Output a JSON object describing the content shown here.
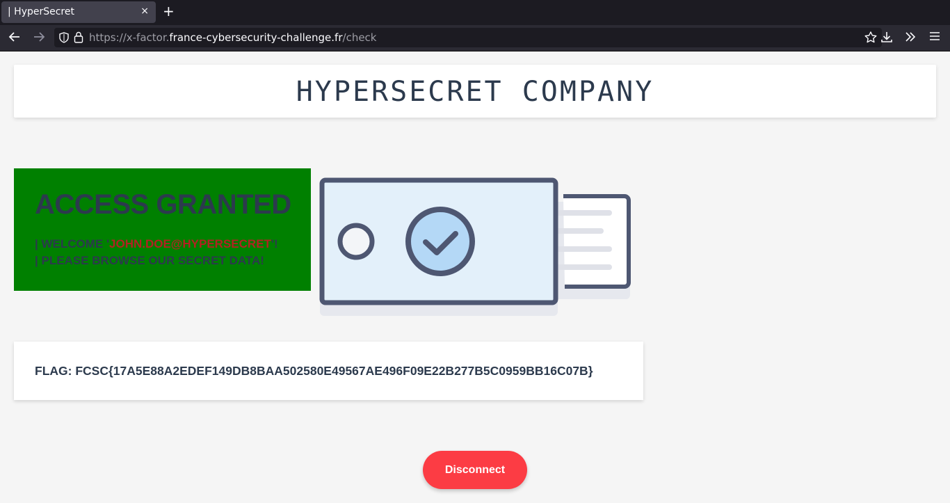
{
  "browser": {
    "tab_title": "| HyperSecret",
    "tab_close": "×",
    "new_tab": "+",
    "url_prefix": "https://x-factor.",
    "url_host": "france-cybersecurity-challenge.fr",
    "url_path": "/check"
  },
  "page": {
    "company_title": "HYPERSECRET COMPANY",
    "access_title": "ACCESS GRANTED",
    "welcome_prefix": "| WELCOME '",
    "welcome_email": "JOHN.DOE@HYPERSECRET",
    "welcome_suffix": "'!",
    "browse_line": "| PLEASE BROWSE OUR SECRET DATA!",
    "flag": "FLAG: FCSC{17A5E88A2EDEF149DB8BAA502580E49567AE496F09E22B277B5C0959BB16C07B}",
    "disconnect_label": "Disconnect"
  },
  "colors": {
    "access_bg": "#008000",
    "disconnect_bg": "#fc3c44",
    "text_dark": "#2c3a4d"
  },
  "icons": [
    "back-arrow-icon",
    "forward-arrow-icon",
    "shield-icon",
    "lock-icon",
    "bookmark-star-icon",
    "download-icon",
    "chevrons-right-icon",
    "hamburger-menu-icon",
    "access-card-illustration"
  ]
}
